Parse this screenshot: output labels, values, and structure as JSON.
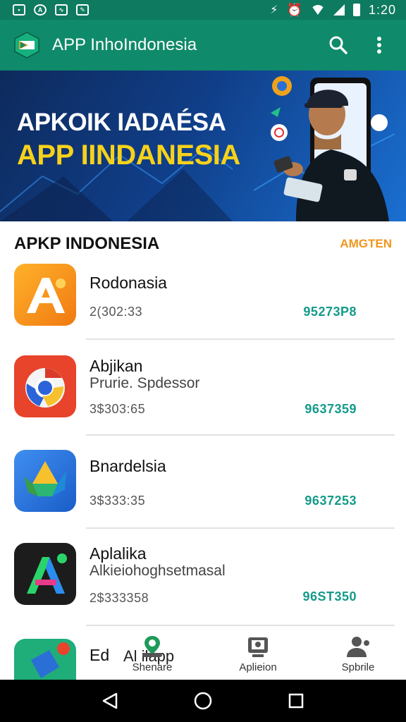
{
  "status_bar": {
    "time": "1:20"
  },
  "app_bar": {
    "title": "APP InhoIndonesia"
  },
  "banner": {
    "line1": "APKOIK IADAÉSA",
    "line2": "APP IINDANESIA"
  },
  "section": {
    "title": "APKP INDONESIA",
    "link": "AMGTEN"
  },
  "apps": [
    {
      "name": "Rodonasia",
      "subtitle": "",
      "meta": "2(302:33",
      "count": "95273P8",
      "icon": "app-a-icon",
      "color": "#f39a1c"
    },
    {
      "name": "Abjikan",
      "subtitle": "Prurie. Spdessor",
      "meta": "3$303:65",
      "count": "9637359",
      "icon": "chrome-like-icon",
      "color": "#e8432b"
    },
    {
      "name": "Bnardelsia",
      "subtitle": "",
      "meta": "3$333:35",
      "count": "9637253",
      "icon": "drive-like-icon",
      "color": "#2a6fd6"
    },
    {
      "name": "Aplalika",
      "subtitle": "Alkieiohoghsetmasal",
      "meta": "2$333358",
      "count": "96ST350",
      "icon": "a-logo-icon",
      "color": "#1c1c1c"
    }
  ],
  "peek": {
    "name": "Ed",
    "name2": "Al     ilapp"
  },
  "tabs": [
    {
      "label": "Shenare",
      "icon": "home-map-icon"
    },
    {
      "label": "Aplieion",
      "icon": "store-icon"
    },
    {
      "label": "Spbrile",
      "icon": "profile-icon"
    }
  ],
  "colors": {
    "primary": "#0f8a6a",
    "status": "#0e7a5f",
    "accent": "#f0961c",
    "count": "#159a8a",
    "banner_yellow": "#f6d21a"
  }
}
